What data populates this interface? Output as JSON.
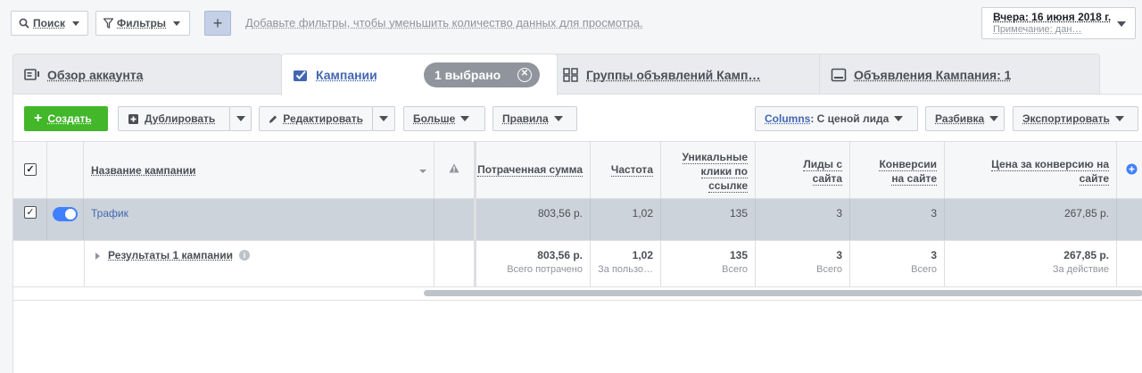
{
  "topbar": {
    "search_label": "Поиск",
    "filters_label": "Фильтры",
    "add_label": "+",
    "filter_hint": "Добавьте фильтры, чтобы уменьшить количество данных для просмотра.",
    "date_label": "Вчера: 16 июня 2018 г.",
    "date_note": "Примечание: дан…"
  },
  "tabs": [
    {
      "label": "Обзор аккаунта",
      "icon": "account-overview-icon"
    },
    {
      "label": "Кампании",
      "icon": "campaign-check-icon",
      "active": true
    },
    {
      "label": "Группы объявлений Камп…",
      "icon": "ad-sets-grid-icon"
    },
    {
      "label": "Объявления Кампания: 1",
      "icon": "ads-monitor-icon"
    }
  ],
  "selection_badge": "1 выбрано",
  "toolbar": {
    "create": "Создать",
    "duplicate": "Дублировать",
    "edit": "Редактировать",
    "more": "Больше",
    "rules": "Правила",
    "columns_prefix": "Columns",
    "columns_value": ": С ценой лида",
    "breakdown": "Разбивка",
    "export": "Экспортировать"
  },
  "table": {
    "headers": {
      "name": "Название кампании",
      "spent": "Потраченная сумма",
      "frequency": "Частота",
      "unique_clicks_1": "Уникальные",
      "unique_clicks_2": "клики по",
      "unique_clicks_3": "ссылке",
      "leads_1": "Лиды с",
      "leads_2": "сайта",
      "conv_1": "Конверсии",
      "conv_2": "на сайте",
      "cpa_1": "Цена за конверсию на",
      "cpa_2": "сайте"
    },
    "rows": [
      {
        "name": "Трафик",
        "spent": "803,56 р.",
        "frequency": "1,02",
        "unique_clicks": "135",
        "leads": "3",
        "conversions": "3",
        "cpa": "267,85 р."
      }
    ],
    "summary": {
      "label": "Результаты 1 кампании",
      "spent": "803,56 р.",
      "spent_sub": "Всего потрачено",
      "frequency": "1,02",
      "frequency_sub": "За пользо…",
      "unique_clicks": "135",
      "unique_clicks_sub": "Всего",
      "leads": "3",
      "leads_sub": "Всего",
      "conversions": "3",
      "conversions_sub": "Всего",
      "cpa": "267,85 р.",
      "cpa_sub": "За действие"
    }
  },
  "colors": {
    "accent": "#4267b2",
    "create_green": "#42b72a",
    "toggle_blue": "#4080ff",
    "selected_row": "#cdd3da"
  }
}
